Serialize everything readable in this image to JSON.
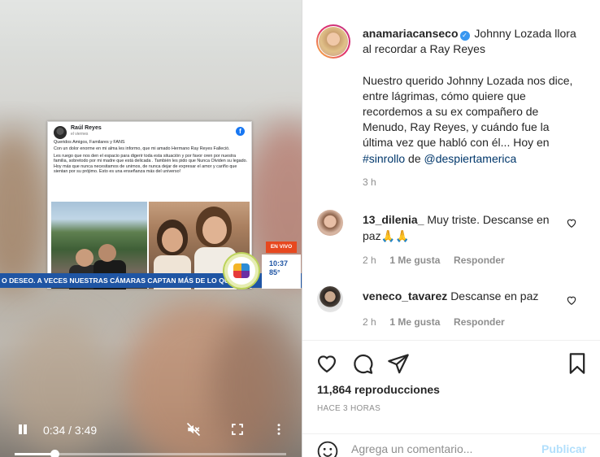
{
  "video": {
    "fb_post": {
      "author": "Raúl Reyes",
      "date": "el viernes",
      "greeting": "Queridos Amigos, Familares y FANS",
      "body_1": "Con un dolor enorme en mi alma les informo, que mi amado Hermano Ray Reyes Falleció.",
      "body_2": "Les ruego que nos den el espacio para digerir toda esta situación y por favor oren por nuestra familia, sobretodo por mi madre que está delicada . También les pido que Nunca Olviden su legado. Hoy más que nunca necesitamos de unirnos, de nunca dejar de expresar el amor y cariño que sientan por su prójimo. Esto es una enseñanza más del universo!"
    },
    "ticker": "O DESEO. A VECES NUESTRAS CÁMARAS CAPTAN MÁS DE LO QUE ES!",
    "live_label": "EN VIVO",
    "clock_time": "10:37",
    "temperature": "85°",
    "current_time": "0:34",
    "separator": "/",
    "duration": "3:49",
    "progress": 0.148
  },
  "post": {
    "username": "anamariacanseco",
    "caption_title": "Johnny Lozada llora al recordar a Ray Reyes",
    "caption_body": "Nuestro querido Johnny Lozada nos dice, entre lágrimas, cómo quiere que recordemos a su ex compañero de Menudo, Ray Reyes, y cuándo fue la última vez que habló con él... Hoy en",
    "hashtag": "#sinrollo",
    "connector": "de",
    "mention": "@despiertamerica",
    "age": "3 h"
  },
  "comments": [
    {
      "username": "13_dilenia_",
      "text": "Muy triste. Descanse en paz",
      "emoji": "🙏🙏",
      "age": "2 h",
      "likes": "1 Me gusta",
      "reply": "Responder"
    },
    {
      "username": "veneco_tavarez",
      "text": "Descanse en paz",
      "emoji": "",
      "age": "2 h",
      "likes": "1 Me gusta",
      "reply": "Responder"
    }
  ],
  "stats": {
    "views": "11,864 reproducciones",
    "posted": "HACE 3 HORAS"
  },
  "add_comment": {
    "placeholder": "Agrega un comentario...",
    "publish": "Publicar"
  },
  "icons": {
    "like": "heart-icon",
    "comment": "comment-icon",
    "share": "share-icon",
    "save": "bookmark-icon",
    "emoji": "emoji-icon",
    "mute": "mute-icon",
    "fullscreen": "fullscreen-icon",
    "more": "more-icon"
  }
}
